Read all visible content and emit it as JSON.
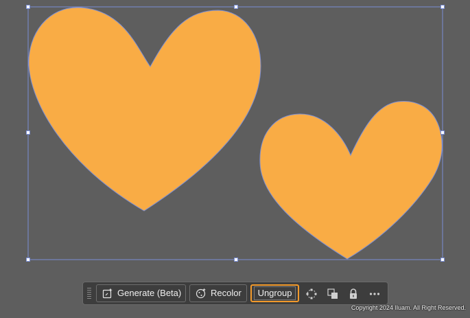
{
  "artwork": {
    "shape_fill": "#f9ac45",
    "outline_color": "#7b8fd6",
    "selection_color": "#7b8fd6"
  },
  "toolbar": {
    "generate_label": "Generate (Beta)",
    "recolor_label": "Recolor",
    "ungroup_label": "Ungroup",
    "highlight_color": "#f39a2b",
    "icons": [
      "generate-icon",
      "recolor-icon",
      "isolate-icon",
      "arrange-icon",
      "lock-icon",
      "more-icon"
    ]
  },
  "copyright": "Copyright 2024 Iluam. All Right Reserved."
}
